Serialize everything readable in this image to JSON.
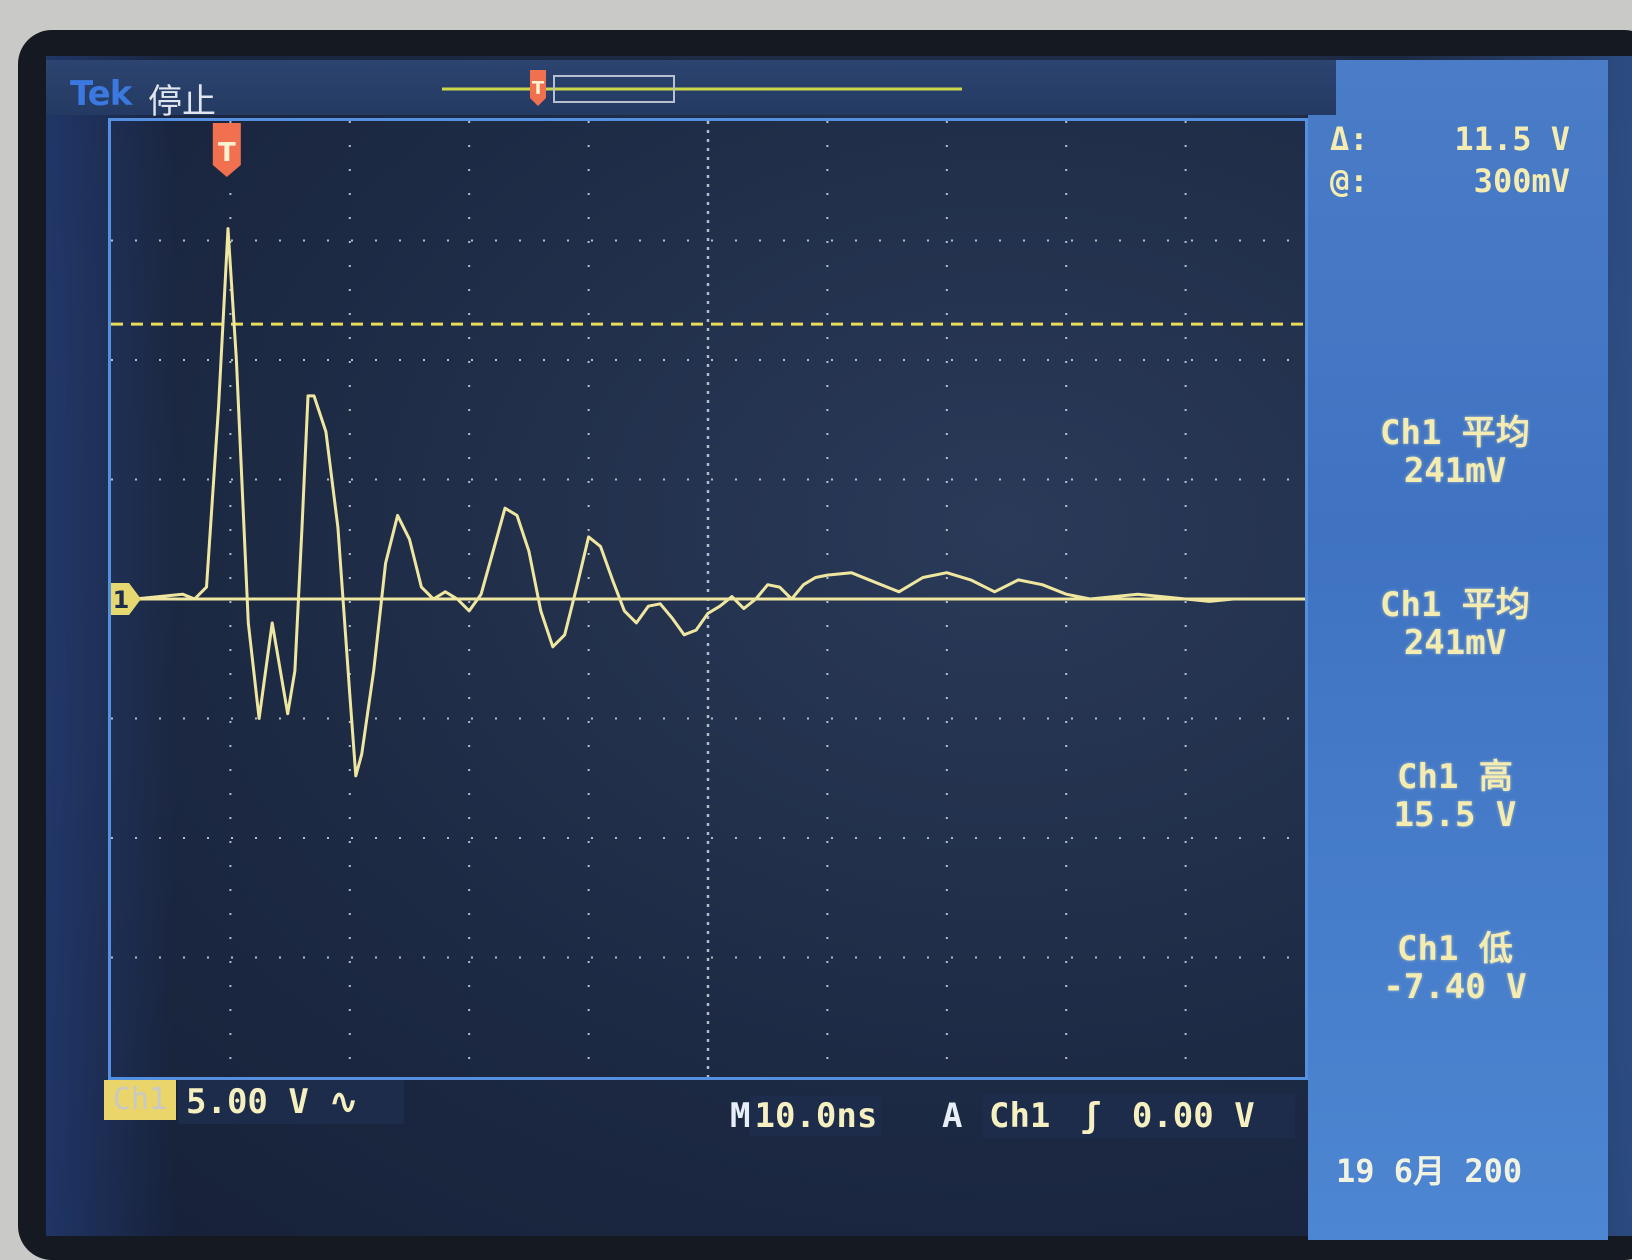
{
  "header": {
    "brand": "Tek",
    "run_state": "停止",
    "trigger_marker": "T"
  },
  "cursor_readout": {
    "delta_label": "Δ:",
    "delta_value": "11.5 V",
    "at_label": "@:",
    "at_value": "300mV"
  },
  "measurements": [
    {
      "title": "Ch1 平均",
      "value": "241mV"
    },
    {
      "title": "Ch1 平均",
      "value": "241mV"
    },
    {
      "title": "Ch1 高",
      "value": "15.5 V"
    },
    {
      "title": "Ch1 低",
      "value": "-7.40 V"
    }
  ],
  "channel_marker": "1",
  "footer": {
    "channel_badge": "Ch1",
    "volts_per_div": "5.00 V",
    "coupling_icon": "ac-coupling-icon",
    "coupling_glyph": "∿",
    "timebase_prefix": "M",
    "timebase": "10.0ns",
    "trigger_prefix": "A",
    "trigger_source": "Ch1",
    "trigger_slope_glyph": "ʃ",
    "trigger_level": "0.00 V",
    "date": "19 6月 200"
  },
  "colors": {
    "trace": "#efe6a0",
    "cursor": "#e8dc5a",
    "grid": "#cfd6e0",
    "side_panel": "#4a7cc7",
    "trigger_marker": "#f07050"
  },
  "chart_data": {
    "type": "line",
    "title": "",
    "xlabel": "",
    "ylabel": "",
    "x_units": "ns",
    "y_units": "V",
    "xlim": [
      -20,
      80
    ],
    "ylim": [
      -20,
      20
    ],
    "cursor_level": 11.5,
    "series": [
      {
        "x": [
          -20,
          -18,
          -16,
          -14,
          -13,
          -12,
          -11,
          -10.2,
          -9.5,
          -8.5,
          -7.6,
          -6.5,
          -5.2,
          -4.6,
          -4,
          -3.5,
          -3,
          -2,
          -1,
          0,
          0.5,
          1,
          2,
          3,
          4,
          5,
          6,
          7,
          8,
          9,
          10,
          11,
          12,
          13,
          14,
          15,
          16,
          17,
          18,
          19,
          20,
          21,
          22,
          23,
          24,
          25,
          26,
          27,
          28,
          29,
          30,
          31,
          32,
          33,
          34,
          35,
          36,
          37,
          38,
          39,
          40,
          42,
          44,
          46,
          48,
          50,
          52,
          54,
          56,
          58,
          60,
          62,
          64,
          66,
          68,
          70,
          72,
          74,
          76,
          78,
          80
        ],
        "y": [
          0,
          0,
          0.1,
          0.2,
          0,
          0.5,
          8,
          15.5,
          10,
          -1,
          -5,
          -1,
          -4.8,
          -3,
          3,
          8.5,
          8.5,
          7,
          3,
          -4,
          -7.4,
          -6.5,
          -3,
          1.5,
          3.5,
          2.5,
          0.5,
          0,
          0.3,
          0,
          -0.5,
          0.2,
          2,
          3.8,
          3.5,
          2,
          -0.5,
          -2,
          -1.5,
          0.5,
          2.6,
          2.2,
          0.8,
          -0.5,
          -1,
          -0.3,
          -0.2,
          -0.8,
          -1.5,
          -1.3,
          -0.6,
          -0.3,
          0.1,
          -0.4,
          0,
          0.6,
          0.5,
          0,
          0.6,
          0.9,
          1.0,
          1.1,
          0.7,
          0.3,
          0.9,
          1.1,
          0.8,
          0.3,
          0.8,
          0.6,
          0.2,
          0,
          0.1,
          0.2,
          0.1,
          0,
          -0.1,
          0,
          0,
          0,
          0
        ]
      }
    ]
  }
}
